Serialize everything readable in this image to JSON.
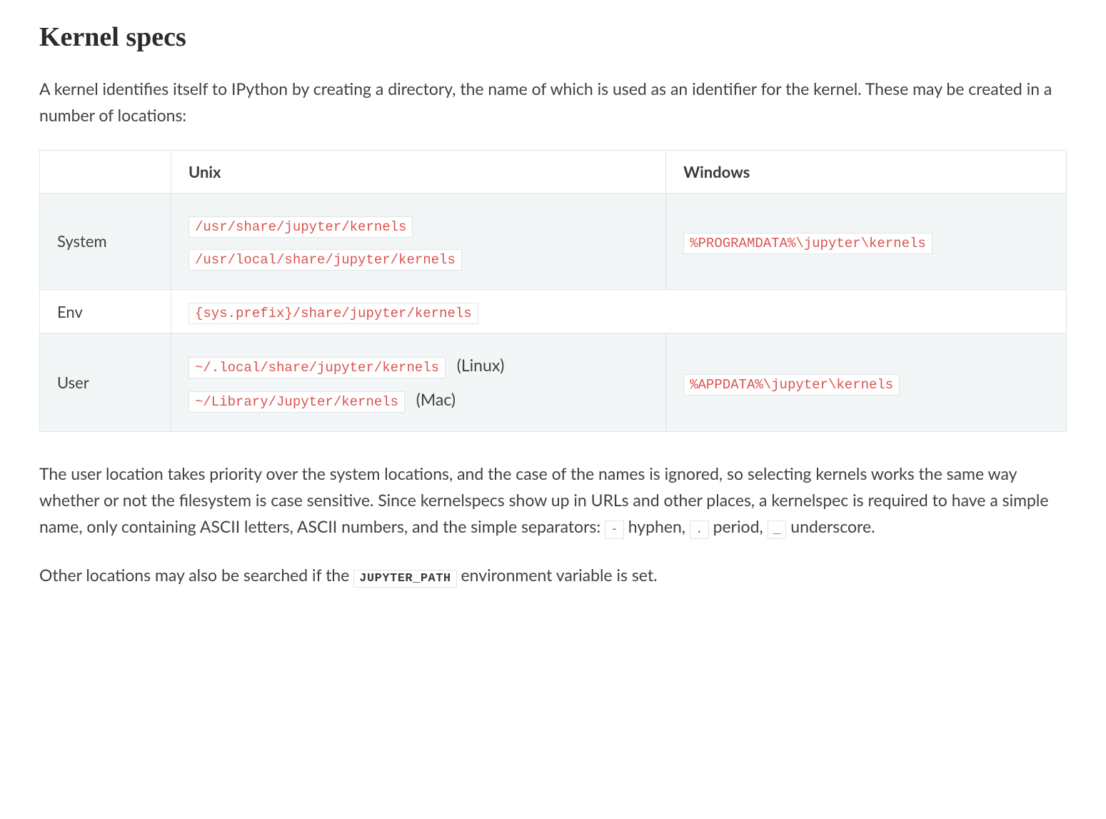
{
  "title": "Kernel specs",
  "intro": "A kernel identifies itself to IPython by creating a directory, the name of which is used as an identifier for the kernel. These may be created in a number of locations:",
  "table": {
    "headers": {
      "blank": "",
      "col1": "Unix",
      "col2": "Windows"
    },
    "rows": {
      "system": {
        "label": "System",
        "unix_a": "/usr/share/jupyter/kernels",
        "unix_b": "/usr/local/share/jupyter/kernels",
        "windows": "%PROGRAMDATA%\\jupyter\\kernels"
      },
      "env": {
        "label": "Env",
        "unix": "{sys.prefix}/share/jupyter/kernels"
      },
      "user": {
        "label": "User",
        "unix_a": "~/.local/share/jupyter/kernels",
        "unix_a_suffix": "(Linux)",
        "unix_b": "~/Library/Jupyter/kernels",
        "unix_b_suffix": "(Mac)",
        "windows": "%APPDATA%\\jupyter\\kernels"
      }
    }
  },
  "para2": {
    "pre": "The user location takes priority over the system locations, and the case of the names is ignored, so selecting kernels works the same way whether or not the filesystem is case sensitive. Since kernelspecs show up in URLs and other places, a kernelspec is required to have a simple name, only containing ASCII letters, ASCII numbers, and the simple separators: ",
    "sep1": "-",
    "sep1_label": " hyphen, ",
    "sep2": ".",
    "sep2_label": " period, ",
    "sep3": "_",
    "sep3_label": " underscore."
  },
  "para3": {
    "pre": "Other locations may also be searched if the ",
    "env_var": "JUPYTER_PATH",
    "post": " environment variable is set."
  }
}
